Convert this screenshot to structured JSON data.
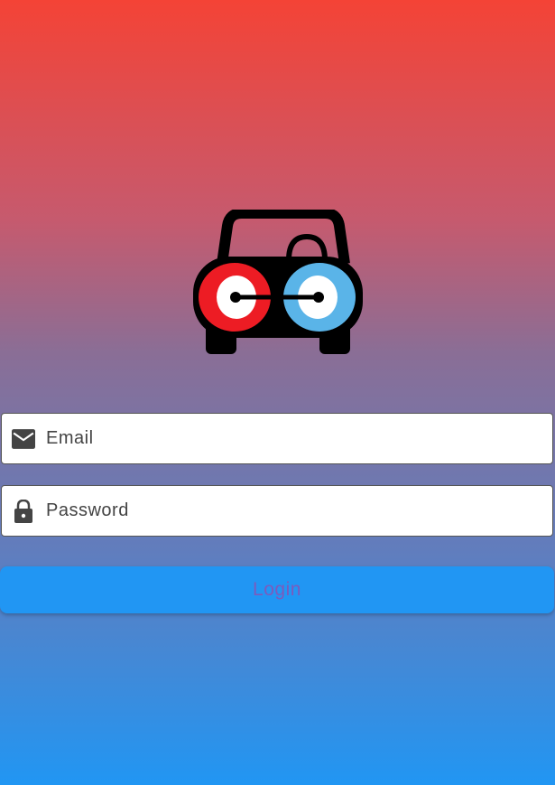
{
  "logo": {
    "icon": "car-logo-icon",
    "colors": {
      "left_light": "#ed1c24",
      "right_light": "#5ab4e8",
      "body": "#000000"
    }
  },
  "form": {
    "email": {
      "placeholder": "Email",
      "icon": "mail-icon"
    },
    "password": {
      "placeholder": "Password",
      "icon": "lock-icon"
    },
    "login_label": "Login"
  },
  "colors": {
    "gradient_top": "#f44336",
    "gradient_bottom": "#2196f3",
    "button": "#2196f3",
    "button_text": "#7b5bbd"
  }
}
